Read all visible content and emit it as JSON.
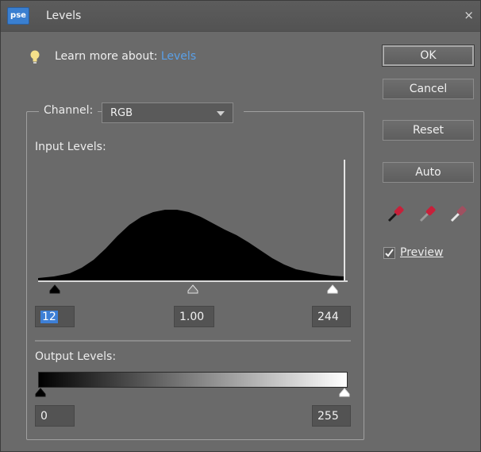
{
  "window": {
    "app_badge": "pse",
    "title": "Levels",
    "close_glyph": "×"
  },
  "help": {
    "prefix": "Learn more about: ",
    "link": "Levels"
  },
  "channel": {
    "label": "Channel:",
    "value": "RGB"
  },
  "input_levels": {
    "label": "Input Levels:",
    "black": "12",
    "gamma": "1.00",
    "white": "244"
  },
  "output_levels": {
    "label": "Output Levels:",
    "black": "0",
    "white": "255"
  },
  "buttons": {
    "ok": "OK",
    "cancel": "Cancel",
    "reset": "Reset",
    "auto": "Auto"
  },
  "eyedroppers": [
    "black-point-eyedropper-icon",
    "gray-point-eyedropper-icon",
    "white-point-eyedropper-icon"
  ],
  "preview": {
    "label": "Preview",
    "checked": true
  },
  "colors": {
    "accent": "#5aa0e8",
    "selection": "#3d7fd6",
    "dropper": "#c8203a"
  }
}
